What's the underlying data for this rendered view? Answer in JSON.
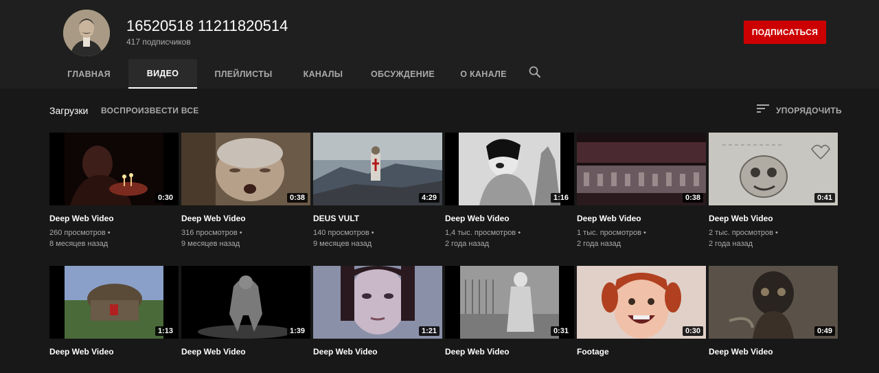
{
  "channel": {
    "name": "16520518 11211820514",
    "subscribers": "417 подписчиков",
    "subscribe_label": "ПОДПИСАТЬСЯ"
  },
  "tabs": [
    {
      "label": "ГЛАВНАЯ"
    },
    {
      "label": "ВИДЕО"
    },
    {
      "label": "ПЛЕЙЛИСТЫ"
    },
    {
      "label": "КАНАЛЫ"
    },
    {
      "label": "ОБСУЖДЕНИЕ"
    },
    {
      "label": "О КАНАЛЕ"
    }
  ],
  "active_tab": "ВИДЕО",
  "shelf": {
    "title": "Загрузки",
    "play_all": "ВОСПРОИЗВЕСТИ ВСЕ",
    "sort_label": "УПОРЯДОЧИТЬ"
  },
  "icons": {
    "search": "search-icon",
    "sort": "sort-icon"
  },
  "colors": {
    "subscribe": "#cc0000",
    "background": "#181818",
    "header": "#1f1f1f"
  },
  "videos": [
    {
      "title": "Deep Web Video",
      "duration": "0:30",
      "views": "260 просмотров •",
      "age": "8 месяцев назад"
    },
    {
      "title": "Deep Web Video",
      "duration": "0:38",
      "views": "316 просмотров •",
      "age": "9 месяцев назад"
    },
    {
      "title": "DEUS VULT",
      "duration": "4:29",
      "views": "140 просмотров •",
      "age": "9 месяцев назад"
    },
    {
      "title": "Deep Web Video",
      "duration": "1:16",
      "views": "1,4 тыс. просмотров •",
      "age": "2 года назад"
    },
    {
      "title": "Deep Web Video",
      "duration": "0:38",
      "views": "1 тыс. просмотров •",
      "age": "2 года назад"
    },
    {
      "title": "Deep Web Video",
      "duration": "0:41",
      "views": "2 тыс. просмотров •",
      "age": "2 года назад"
    },
    {
      "title": "Deep Web Video",
      "duration": "1:13"
    },
    {
      "title": "Deep Web Video",
      "duration": "1:39"
    },
    {
      "title": "Deep Web Video",
      "duration": "1:21"
    },
    {
      "title": "Deep Web Video",
      "duration": "0:31"
    },
    {
      "title": "Footage",
      "duration": "0:30"
    },
    {
      "title": "Deep Web Video",
      "duration": "0:49"
    }
  ]
}
